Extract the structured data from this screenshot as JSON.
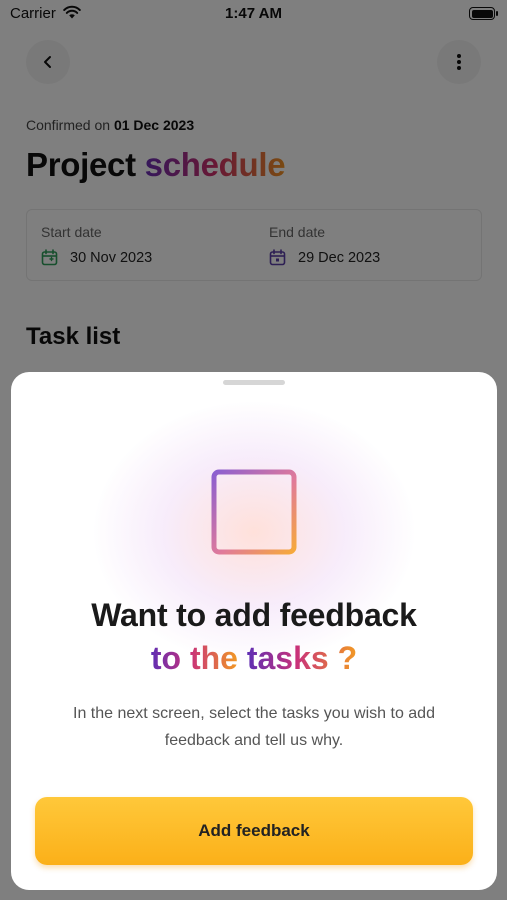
{
  "status_bar": {
    "carrier": "Carrier",
    "time": "1:47 AM"
  },
  "header": {
    "confirmed_prefix": "Confirmed on",
    "confirmed_date": "01 Dec 2023",
    "title_plain": "Project",
    "title_highlight": "schedule"
  },
  "dates": {
    "start_label": "Start date",
    "start_value": "30 Nov 2023",
    "end_label": "End date",
    "end_value": "29 Dec 2023"
  },
  "task_list": {
    "heading": "Task list"
  },
  "sheet": {
    "headline_line1": "Want to add feedback",
    "headline_line2_a": "to the",
    "headline_line2_b": "tasks ?",
    "description": "In the next screen, select the tasks you wish to add feedback and tell us why.",
    "button_label": "Add feedback"
  },
  "icons": [
    "wifi-icon",
    "battery-icon",
    "back-icon",
    "more-vertical-icon",
    "calendar-start-icon",
    "calendar-end-icon",
    "document-lines-icon"
  ],
  "colors": {
    "accent_purple": "#6a2fb6",
    "accent_pink": "#d0306a",
    "accent_orange": "#f39423",
    "button_yellow": "#fbb019"
  }
}
